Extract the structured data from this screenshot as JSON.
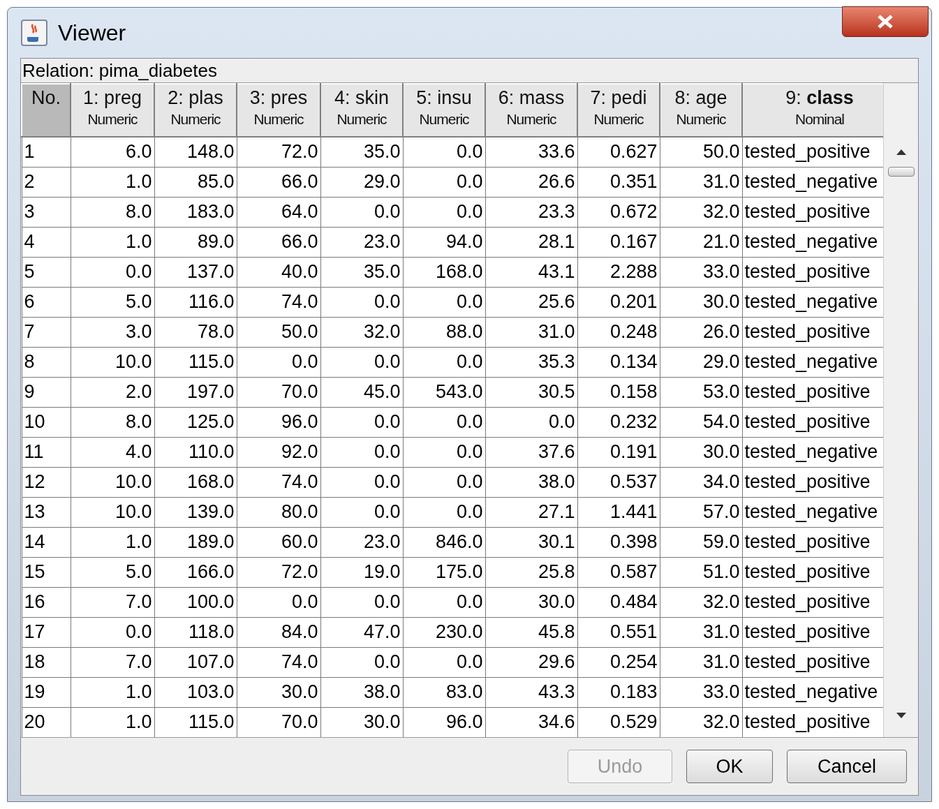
{
  "window": {
    "title": "Viewer"
  },
  "relation": "Relation: pima_diabetes",
  "table": {
    "columns": [
      {
        "name": "No."
      },
      {
        "name": "1: preg",
        "type": "Numeric"
      },
      {
        "name": "2: plas",
        "type": "Numeric"
      },
      {
        "name": "3: pres",
        "type": "Numeric"
      },
      {
        "name": "4: skin",
        "type": "Numeric"
      },
      {
        "name": "5: insu",
        "type": "Numeric"
      },
      {
        "name": "6: mass",
        "type": "Numeric"
      },
      {
        "name": "7: pedi",
        "type": "Numeric"
      },
      {
        "name": "8: age",
        "type": "Numeric"
      },
      {
        "name": "9: **class**",
        "type": "Nominal"
      }
    ],
    "rows": [
      [
        "1",
        "6.0",
        "148.0",
        "72.0",
        "35.0",
        "0.0",
        "33.6",
        "0.627",
        "50.0",
        "tested_positive"
      ],
      [
        "2",
        "1.0",
        "85.0",
        "66.0",
        "29.0",
        "0.0",
        "26.6",
        "0.351",
        "31.0",
        "tested_negative"
      ],
      [
        "3",
        "8.0",
        "183.0",
        "64.0",
        "0.0",
        "0.0",
        "23.3",
        "0.672",
        "32.0",
        "tested_positive"
      ],
      [
        "4",
        "1.0",
        "89.0",
        "66.0",
        "23.0",
        "94.0",
        "28.1",
        "0.167",
        "21.0",
        "tested_negative"
      ],
      [
        "5",
        "0.0",
        "137.0",
        "40.0",
        "35.0",
        "168.0",
        "43.1",
        "2.288",
        "33.0",
        "tested_positive"
      ],
      [
        "6",
        "5.0",
        "116.0",
        "74.0",
        "0.0",
        "0.0",
        "25.6",
        "0.201",
        "30.0",
        "tested_negative"
      ],
      [
        "7",
        "3.0",
        "78.0",
        "50.0",
        "32.0",
        "88.0",
        "31.0",
        "0.248",
        "26.0",
        "tested_positive"
      ],
      [
        "8",
        "10.0",
        "115.0",
        "0.0",
        "0.0",
        "0.0",
        "35.3",
        "0.134",
        "29.0",
        "tested_negative"
      ],
      [
        "9",
        "2.0",
        "197.0",
        "70.0",
        "45.0",
        "543.0",
        "30.5",
        "0.158",
        "53.0",
        "tested_positive"
      ],
      [
        "10",
        "8.0",
        "125.0",
        "96.0",
        "0.0",
        "0.0",
        "0.0",
        "0.232",
        "54.0",
        "tested_positive"
      ],
      [
        "11",
        "4.0",
        "110.0",
        "92.0",
        "0.0",
        "0.0",
        "37.6",
        "0.191",
        "30.0",
        "tested_negative"
      ],
      [
        "12",
        "10.0",
        "168.0",
        "74.0",
        "0.0",
        "0.0",
        "38.0",
        "0.537",
        "34.0",
        "tested_positive"
      ],
      [
        "13",
        "10.0",
        "139.0",
        "80.0",
        "0.0",
        "0.0",
        "27.1",
        "1.441",
        "57.0",
        "tested_negative"
      ],
      [
        "14",
        "1.0",
        "189.0",
        "60.0",
        "23.0",
        "846.0",
        "30.1",
        "0.398",
        "59.0",
        "tested_positive"
      ],
      [
        "15",
        "5.0",
        "166.0",
        "72.0",
        "19.0",
        "175.0",
        "25.8",
        "0.587",
        "51.0",
        "tested_positive"
      ],
      [
        "16",
        "7.0",
        "100.0",
        "0.0",
        "0.0",
        "0.0",
        "30.0",
        "0.484",
        "32.0",
        "tested_positive"
      ],
      [
        "17",
        "0.0",
        "118.0",
        "84.0",
        "47.0",
        "230.0",
        "45.8",
        "0.551",
        "31.0",
        "tested_positive"
      ],
      [
        "18",
        "7.0",
        "107.0",
        "74.0",
        "0.0",
        "0.0",
        "29.6",
        "0.254",
        "31.0",
        "tested_positive"
      ],
      [
        "19",
        "1.0",
        "103.0",
        "30.0",
        "38.0",
        "83.0",
        "43.3",
        "0.183",
        "33.0",
        "tested_negative"
      ],
      [
        "20",
        "1.0",
        "115.0",
        "70.0",
        "30.0",
        "96.0",
        "34.6",
        "0.529",
        "32.0",
        "tested_positive"
      ]
    ]
  },
  "buttons": [
    {
      "label": "Undo",
      "disabled": true
    },
    {
      "label": "OK",
      "disabled": false
    },
    {
      "label": "Cancel",
      "disabled": false
    }
  ]
}
